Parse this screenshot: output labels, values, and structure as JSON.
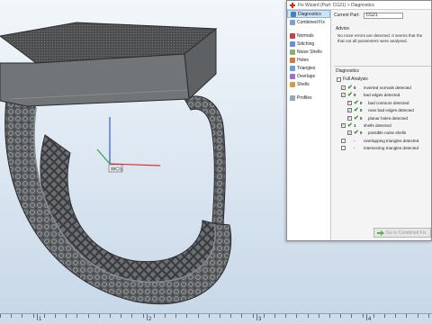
{
  "viewport": {
    "axis_label": "WCS",
    "ruler_labels": [
      "1",
      "2",
      "3",
      "4"
    ]
  },
  "wizard": {
    "title": "Fix Wizard (Part: CG21) > Diagnostics",
    "nav_primary": [
      {
        "label": "Diagnostics",
        "icon": "diagnostics-icon",
        "active": true
      },
      {
        "label": "Combined Fix",
        "icon": "combined-fix-icon",
        "active": false
      }
    ],
    "nav_tools": [
      {
        "label": "Normals",
        "icon": "normals-icon"
      },
      {
        "label": "Stitching",
        "icon": "stitching-icon"
      },
      {
        "label": "Noise Shells",
        "icon": "noise-shells-icon"
      },
      {
        "label": "Holes",
        "icon": "holes-icon"
      },
      {
        "label": "Triangles",
        "icon": "triangles-icon"
      },
      {
        "label": "Overlaps",
        "icon": "overlaps-icon"
      },
      {
        "label": "Shells",
        "icon": "shells-icon"
      }
    ],
    "nav_profiles": {
      "label": "Profiles",
      "icon": "profiles-icon"
    },
    "current_part_label": "Current Part:",
    "current_part_value": "CG21",
    "advice_title": "Advice",
    "advice_line1": "No more errors are detected. It seems that the",
    "advice_line2": "that not all parameters were analysed.",
    "diagnostics_title": "Diagnostics",
    "full_analysis_label": "Full Analysis",
    "rows": [
      {
        "label": "inverted normals detected",
        "count": "0",
        "indent": 0,
        "state": "check"
      },
      {
        "label": "bad edges detected",
        "count": "0",
        "indent": 0,
        "state": "check"
      },
      {
        "label": "bad contours detected",
        "count": "0",
        "indent": 1,
        "state": "check"
      },
      {
        "label": "near bad edges detected",
        "count": "0",
        "indent": 1,
        "state": "check"
      },
      {
        "label": "planar holes detected",
        "count": "0",
        "indent": 1,
        "state": "check"
      },
      {
        "label": "shells detected",
        "count": "1",
        "indent": 0,
        "state": "check"
      },
      {
        "label": "possible noise shells",
        "count": "0",
        "indent": 1,
        "state": "check"
      },
      {
        "label": "overlapping triangles detected",
        "count": "-",
        "indent": 0,
        "state": "minus"
      },
      {
        "label": "intersecting triangles detected",
        "count": "-",
        "indent": 0,
        "state": "minus"
      }
    ],
    "next_button_label": "Go to Combined Fix"
  },
  "colors": {
    "accent": "#cde3f7",
    "check_green": "#2b9a2b",
    "minus_red": "#c02020",
    "axis_x": "#e0302a",
    "axis_y": "#2aa84a",
    "axis_z": "#2a5ad8"
  }
}
